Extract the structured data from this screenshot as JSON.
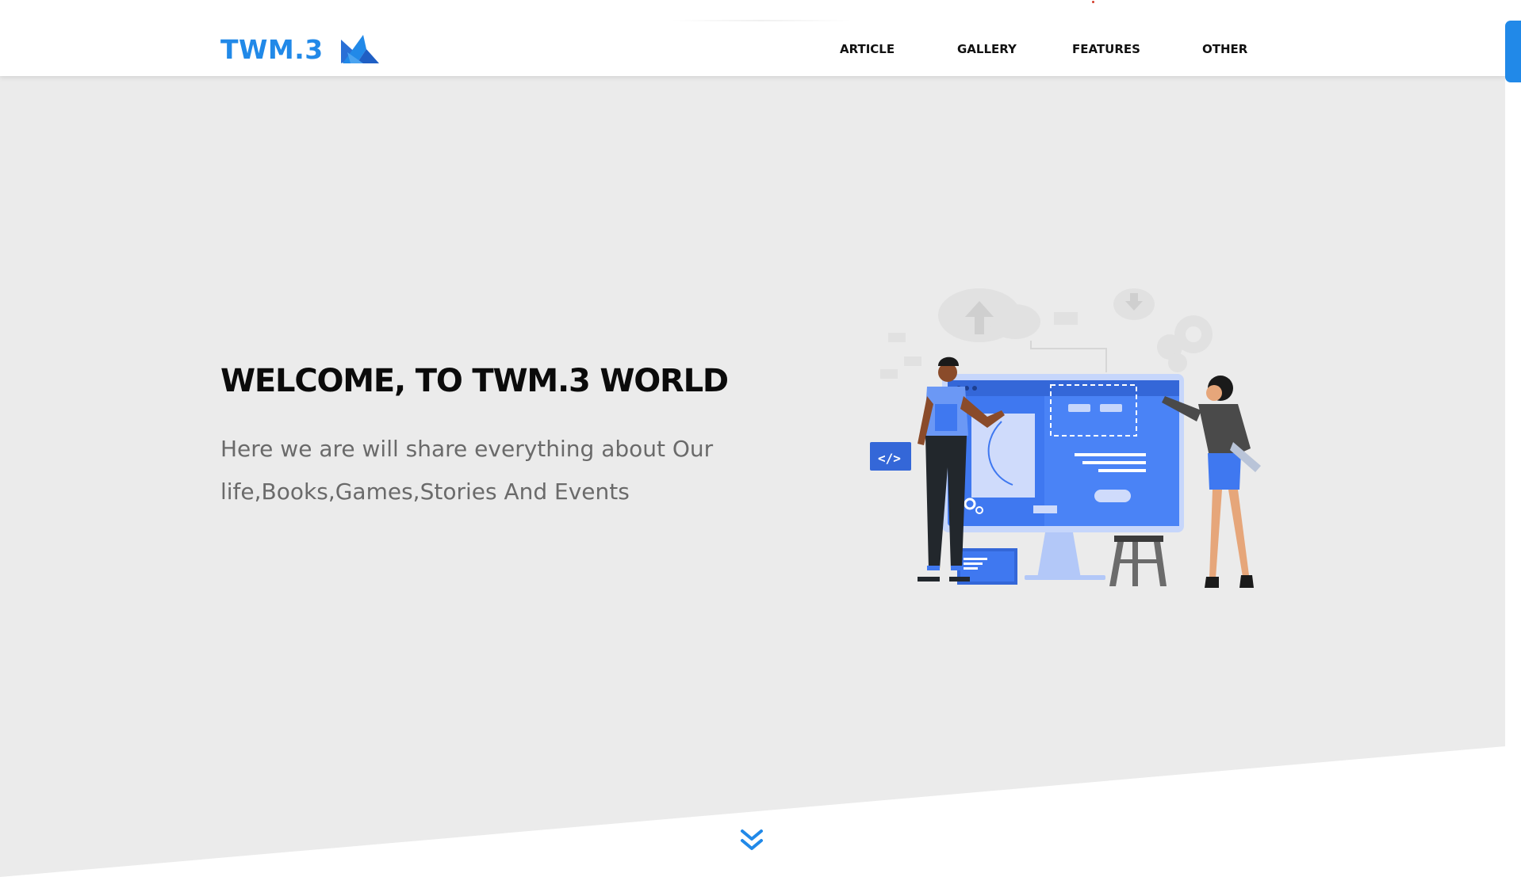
{
  "header": {
    "logo_text": "TWM.3",
    "nav": [
      {
        "label": "ARTICLE"
      },
      {
        "label": "GALLERY"
      },
      {
        "label": "FEATURES"
      },
      {
        "label": "OTHER"
      }
    ]
  },
  "hero": {
    "title": "WELCOME, TO TWM.3 WORLD",
    "subtitle": "Here we are will share everything about Our life,Books,Games,Stories And Events"
  },
  "colors": {
    "accent": "#2189e8",
    "illustration_blue": "#3f78f0",
    "hero_background": "#ebebeb",
    "title": "#0b0b0b",
    "subtitle": "#6a6a6a"
  },
  "icons": {
    "logo_mark": "logo-mark-icon",
    "scroll_down": "double-chevron-down-icon"
  }
}
